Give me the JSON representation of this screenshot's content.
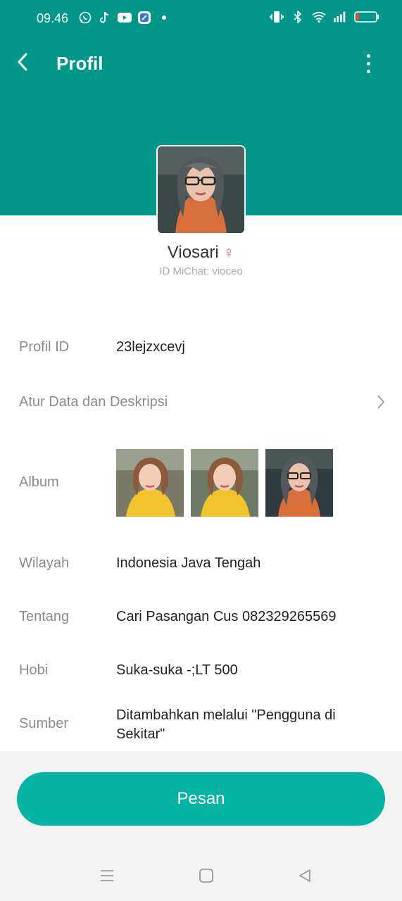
{
  "status_bar": {
    "time": "09.46"
  },
  "appbar": {
    "title": "Profil"
  },
  "profile": {
    "name": "Viosari",
    "gender_symbol": "♀",
    "michat_id": "ID MiChat: vioceo"
  },
  "rows": {
    "profile_id": {
      "label": "Profil ID",
      "value": "23lejzxcevj"
    },
    "manage_data": {
      "label": "Atur Data dan Deskripsi"
    },
    "album": {
      "label": "Album"
    },
    "region": {
      "label": "Wilayah",
      "value": "Indonesia Java Tengah"
    },
    "about": {
      "label": "Tentang",
      "value": "Cari Pasangan Cus 082329265569"
    },
    "hobby": {
      "label": "Hobi",
      "value": "Suka-suka -;LT 500"
    },
    "source": {
      "label": "Sumber",
      "value_line1": "Ditambahkan melalui \"Pengguna di",
      "value_line2": "Sekitar\""
    }
  },
  "action": {
    "message_button": "Pesan"
  },
  "colors": {
    "header": "#009688",
    "button": "#05b3a3",
    "gender": "#ea5b73"
  }
}
